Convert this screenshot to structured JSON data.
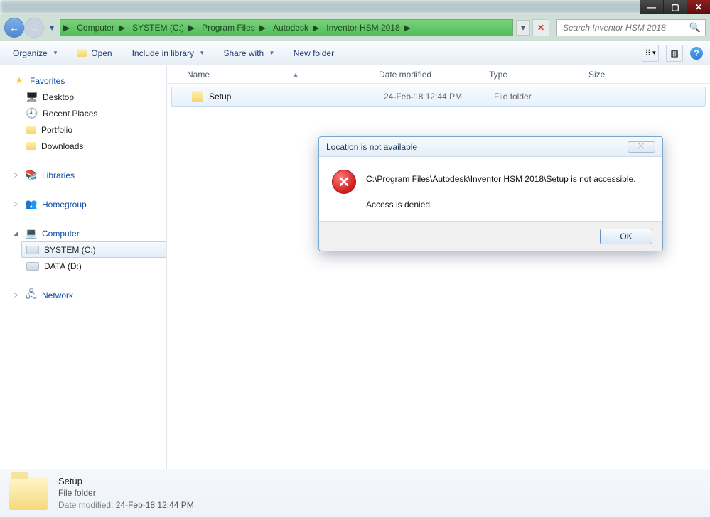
{
  "window": {
    "min": "—",
    "max": "▢",
    "close": "✕"
  },
  "nav": {
    "back_glyph": "←",
    "fwd_glyph": "→",
    "history_glyph": "▾",
    "refresh_glyph_x": "✕",
    "dropdown_glyph": "▾"
  },
  "breadcrumbs": [
    "Computer",
    "SYSTEM (C:)",
    "Program Files",
    "Autodesk",
    "Inventor HSM 2018"
  ],
  "search": {
    "placeholder": "Search Inventor HSM 2018",
    "mag": "🔍"
  },
  "toolbar": {
    "organize": "Organize",
    "open": "Open",
    "include": "Include in library",
    "share": "Share with",
    "newfolder": "New folder",
    "view_glyph": "⠿",
    "pane_glyph": "▥",
    "help": "?"
  },
  "sidebar": {
    "favorites": "Favorites",
    "fav_items": [
      "Desktop",
      "Recent Places",
      "Portfolio",
      "Downloads"
    ],
    "libraries": "Libraries",
    "homegroup": "Homegroup",
    "computer": "Computer",
    "drives": [
      "SYSTEM (C:)",
      "DATA (D:)"
    ],
    "network": "Network"
  },
  "columns": {
    "name": "Name",
    "date": "Date modified",
    "type": "Type",
    "size": "Size",
    "sort": "▲"
  },
  "rows": [
    {
      "name": "Setup",
      "date": "24-Feb-18 12:44 PM",
      "type": "File folder",
      "size": ""
    }
  ],
  "details": {
    "name": "Setup",
    "type": "File folder",
    "date_label": "Date modified:",
    "date": "24-Feb-18 12:44 PM"
  },
  "dialog": {
    "title": "Location is not available",
    "close_glyph": "⤬",
    "error_glyph": "✕",
    "line1": "C:\\Program Files\\Autodesk\\Inventor HSM 2018\\Setup is not accessible.",
    "line2": "Access is denied.",
    "ok": "OK"
  }
}
